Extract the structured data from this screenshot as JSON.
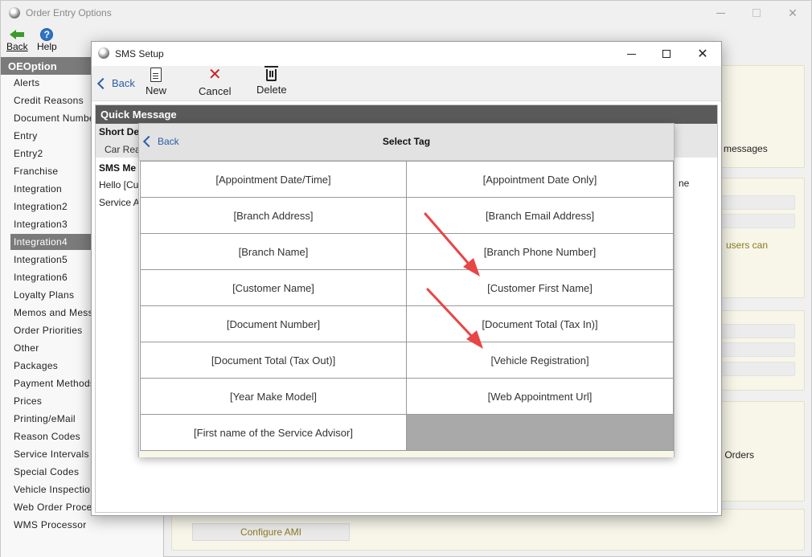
{
  "main_window": {
    "title": "Order Entry Options",
    "back_label": "Back",
    "help_label": "Help"
  },
  "sidebar": {
    "header": "OEOption",
    "selected_index": 9,
    "items": [
      "Alerts",
      "Credit Reasons",
      "Document Numbe",
      "Entry",
      "Entry2",
      "Franchise",
      "Integration",
      "Integration2",
      "Integration3",
      "Integration4",
      "Integration5",
      "Integration6",
      "Loyalty Plans",
      "Memos and Mess",
      "Order Priorities",
      "Other",
      "Packages",
      "Payment Methods",
      "Prices",
      "Printing/eMail",
      "Reason Codes",
      "Service Intervals",
      "Special Codes",
      "Vehicle Inspectio",
      "Web Order Proce",
      "WMS Processor"
    ]
  },
  "right_panel": {
    "text_messages": "messages",
    "text_users_can": "users can",
    "text_orders": "r Orders",
    "configure_button": "Configure AMI"
  },
  "sms_setup": {
    "title": "SMS Setup",
    "toolbar": {
      "back": "Back",
      "new": "New",
      "cancel": "Cancel",
      "delete": "Delete"
    },
    "section_title": "Quick Message",
    "short_desc_label": "Short De",
    "short_desc_value": "Car Rea",
    "sms_message_label": "SMS Me",
    "message_line1": "Hello [Cu",
    "message_line2": "Service A",
    "message_tail": "ne"
  },
  "select_tag": {
    "back": "Back",
    "title": "Select Tag",
    "tags": [
      "[Appointment Date/Time]",
      "[Appointment Date Only]",
      "[Branch Address]",
      "[Branch Email Address]",
      "[Branch Name]",
      "[Branch Phone Number]",
      "[Customer Name]",
      "[Customer First Name]",
      "[Document Number]",
      "[Document Total (Tax In)]",
      "[Document Total (Tax Out)]",
      "[Vehicle Registration]",
      "[Year Make Model]",
      "[Web Appointment Url]",
      "[First name of the Service Advisor]",
      ""
    ]
  },
  "icons": {
    "back": "back-arrow-icon",
    "help": "help-icon",
    "new": "document-icon",
    "cancel": "x-icon",
    "delete": "trash-icon"
  },
  "colors": {
    "accent_blue": "#2a5ea8",
    "annotation_arrow": "#e84545",
    "sidebar_selected": "#7b7b7b",
    "header_dark": "#5a5a5a",
    "olive_text": "#8a7a1f"
  }
}
